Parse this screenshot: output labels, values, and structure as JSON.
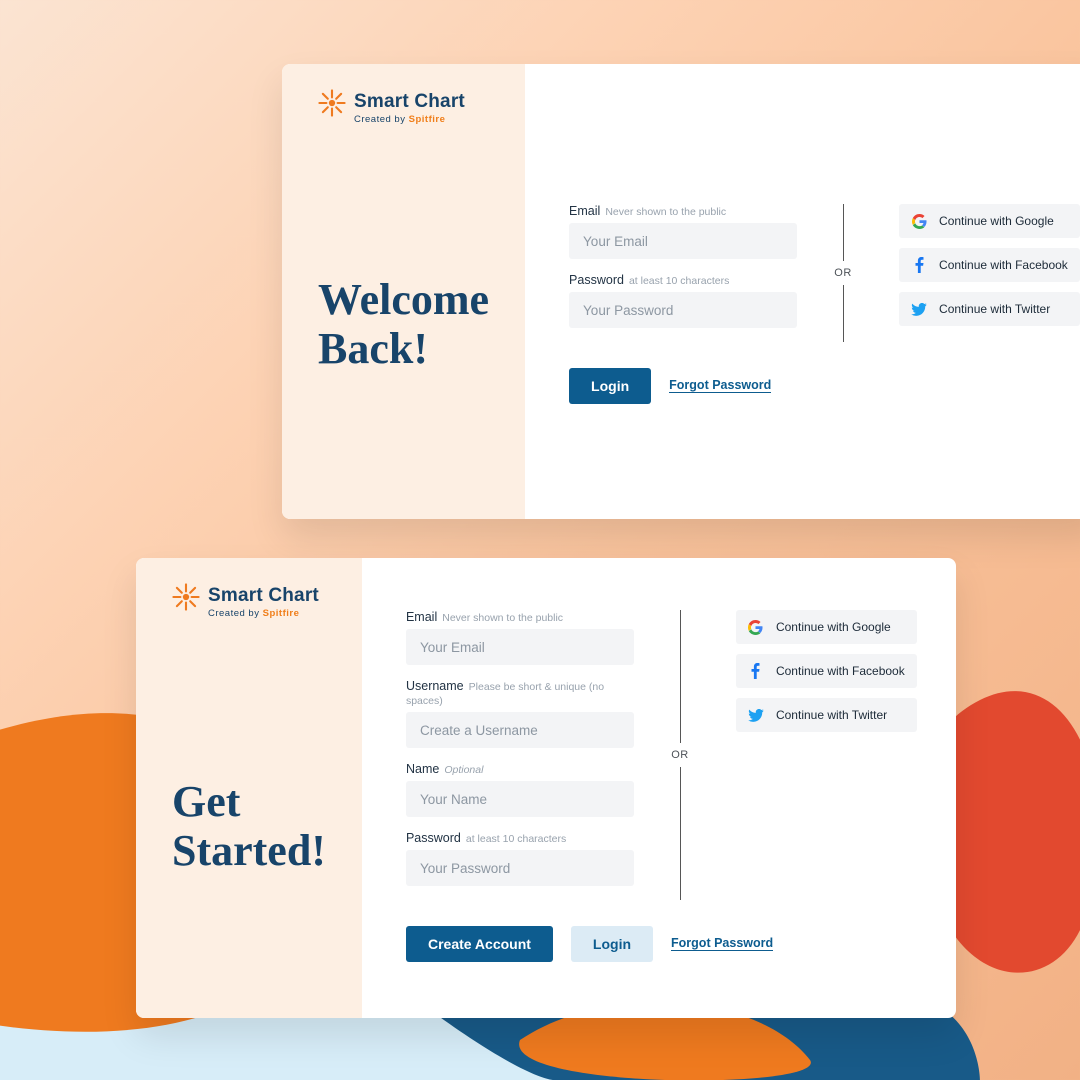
{
  "brand": {
    "name": "Smart Chart",
    "byline_prefix": "Created by ",
    "byline_brand": "Spitfire"
  },
  "login": {
    "title": "Welcome Back!",
    "email_label": "Email",
    "email_hint": "Never shown to the public",
    "email_placeholder": "Your Email",
    "password_label": "Password",
    "password_hint": "at least 10 characters",
    "password_placeholder": "Your Password",
    "submit": "Login",
    "forgot": "Forgot Password",
    "or": "OR"
  },
  "signup": {
    "title": "Get Started!",
    "email_label": "Email",
    "email_hint": "Never shown to the public",
    "email_placeholder": "Your Email",
    "username_label": "Username",
    "username_hint": "Please be short & unique (no spaces)",
    "username_placeholder": "Create a Username",
    "name_label": "Name",
    "name_hint": "Optional",
    "name_placeholder": "Your Name",
    "password_label": "Password",
    "password_hint": "at least 10 characters",
    "password_placeholder": "Your Password",
    "create": "Create Account",
    "login": "Login",
    "forgot": "Forgot Password",
    "or": "OR"
  },
  "social": {
    "google": "Continue with Google",
    "facebook": "Continue with Facebook",
    "twitter": "Continue with Twitter"
  },
  "colors": {
    "primary": "#0d5c8f",
    "accent": "#f07e1a",
    "panel": "#fdefe3"
  }
}
